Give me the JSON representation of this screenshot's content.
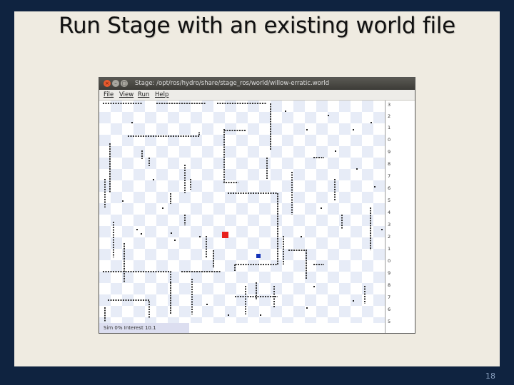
{
  "slide": {
    "title": "Run Stage with an existing world file",
    "page_number": "18"
  },
  "window": {
    "title": "Stage: /opt/ros/hydro/share/stage_ros/world/willow-erratic.world",
    "controls": {
      "close": "×",
      "minimize": "–",
      "maximize": "□"
    },
    "menu": [
      "File",
      "View",
      "Run",
      "Help"
    ],
    "ruler_labels": [
      "3",
      "2",
      "1",
      "0",
      "9",
      "8",
      "7",
      "6",
      "5",
      "4",
      "3",
      "2",
      "1",
      "0",
      "9",
      "8",
      "7",
      "6",
      "5"
    ],
    "status_text": "Sim 0% Interest 10.1"
  },
  "colors": {
    "slide_bg": "#efebe1",
    "frame": "#0f2340",
    "robot1": "#e8211e",
    "robot2": "#1533b8"
  }
}
